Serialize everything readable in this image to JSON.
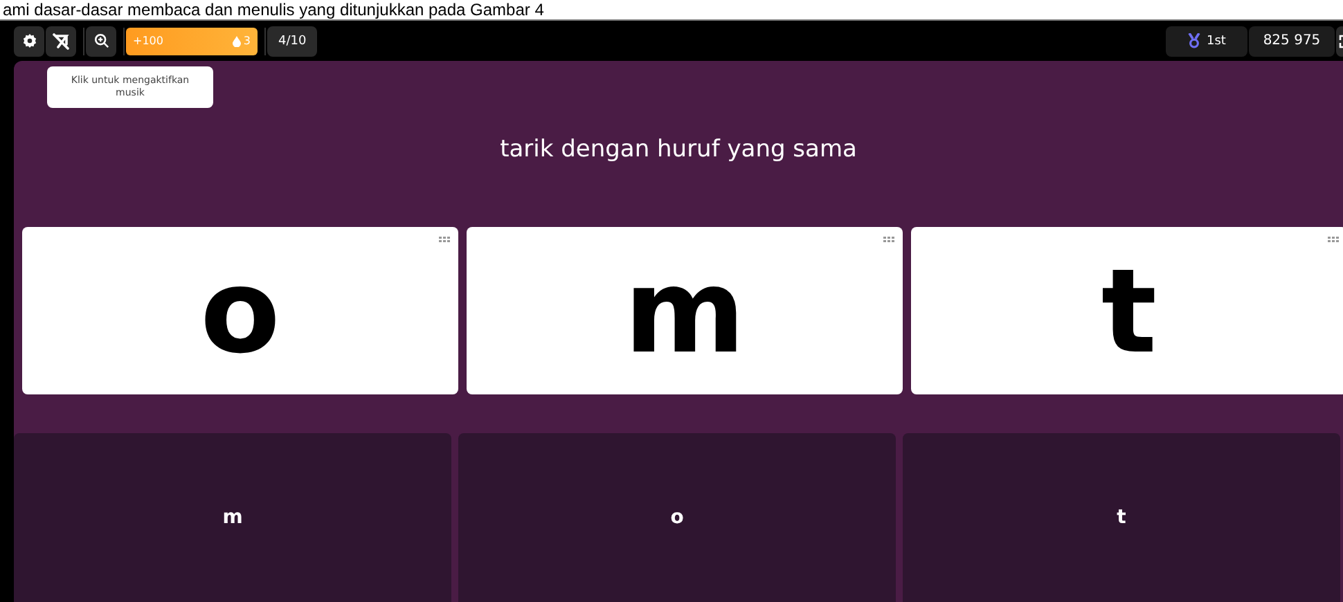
{
  "caption": "ami dasar-dasar membaca dan menulis yang ditunjukkan pada Gambar 4",
  "toolbar": {
    "score_bar": {
      "points": "+100",
      "drops": "3"
    },
    "progress": "4/10",
    "rank": "1st",
    "total_score": "825 975"
  },
  "tooltip": "Klik untuk mengaktifkan musik",
  "prompt": "tarik dengan huruf yang sama",
  "cards": [
    {
      "letter": "o"
    },
    {
      "letter": "m"
    },
    {
      "letter": "t"
    }
  ],
  "answers": [
    {
      "letter": "m"
    },
    {
      "letter": "o"
    },
    {
      "letter": "t"
    }
  ]
}
